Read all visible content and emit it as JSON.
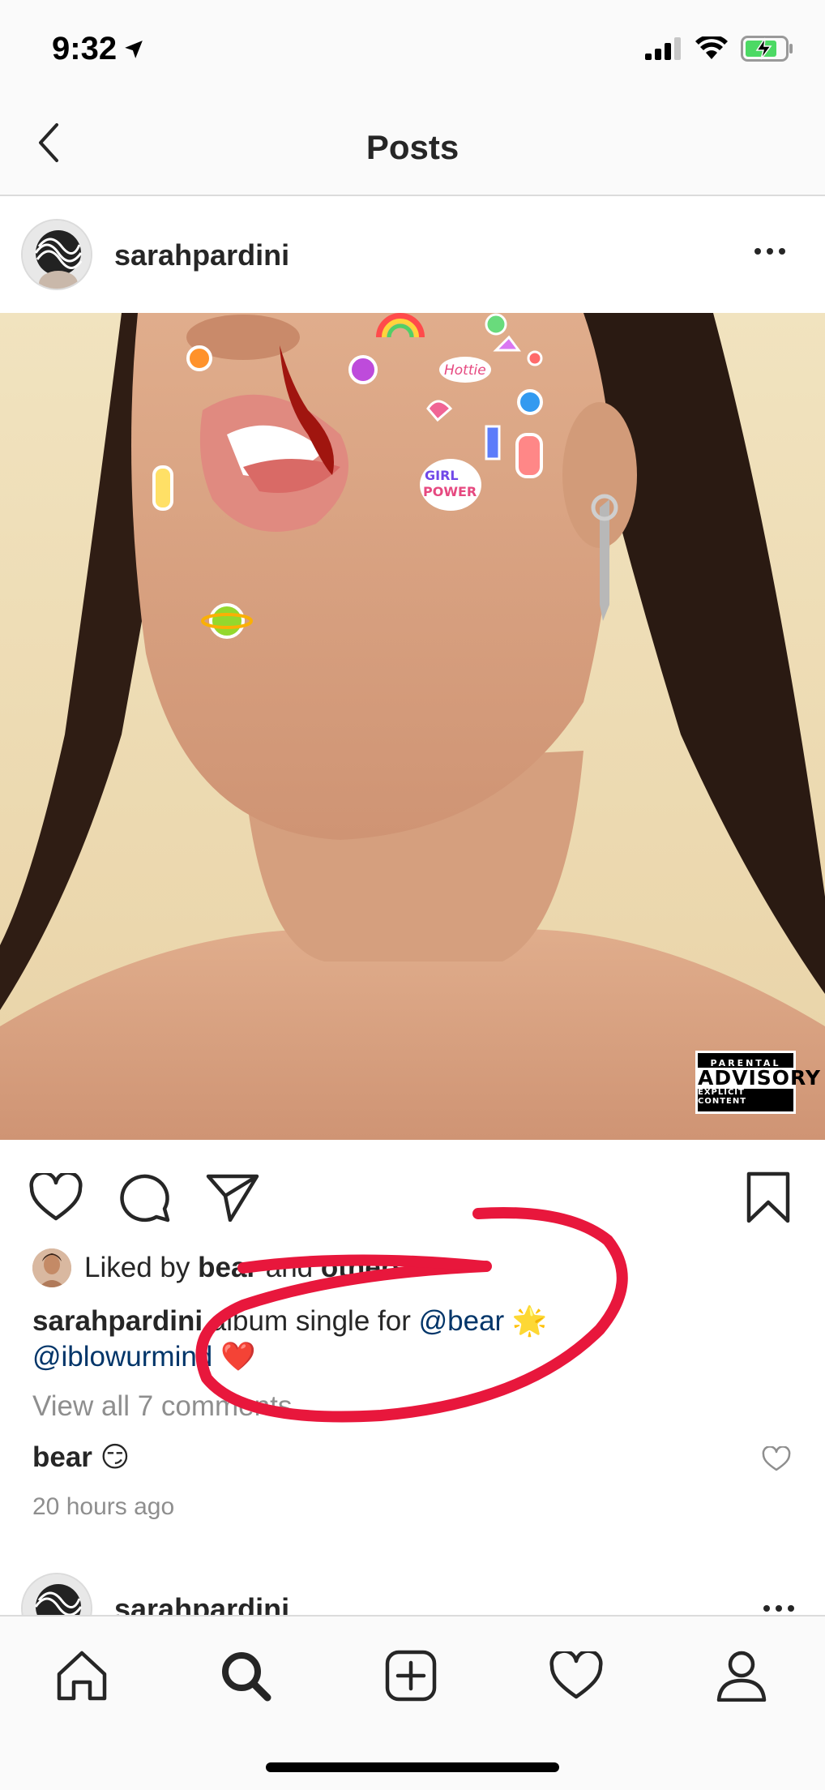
{
  "status_bar": {
    "time": "9:32",
    "location_icon": "location-arrow-icon",
    "signal_icon": "cellular-signal-icon",
    "wifi_icon": "wifi-icon",
    "battery_icon": "battery-charging-icon"
  },
  "nav": {
    "title": "Posts",
    "back_icon": "chevron-left-icon"
  },
  "post": {
    "username": "sarahpardini",
    "advisory": {
      "top": "PARENTAL",
      "middle": "ADVISORY",
      "bottom": "EXPLICIT CONTENT"
    },
    "likes": {
      "prefix": "Liked by ",
      "user": "bear",
      "mid": " and ",
      "others": "others"
    },
    "caption": {
      "author": "sarahpardini",
      "text": " album single for ",
      "mention1": "@bear",
      "emoji1": " 🌟",
      "mention2": "@iblowurmind",
      "emoji2": " ❤️"
    },
    "view_comments": "View all 7 comments",
    "comment": {
      "author": "bear",
      "text": " 😏"
    },
    "timestamp": "20 hours ago"
  },
  "next_post": {
    "username": "sarahpardini"
  },
  "tabs": [
    {
      "icon": "home-icon"
    },
    {
      "icon": "search-icon"
    },
    {
      "icon": "add-post-icon"
    },
    {
      "icon": "heart-icon"
    },
    {
      "icon": "profile-icon"
    }
  ],
  "colors": {
    "mention": "#003569",
    "annotation": "#e8173c",
    "muted": "#8e8e8e"
  }
}
